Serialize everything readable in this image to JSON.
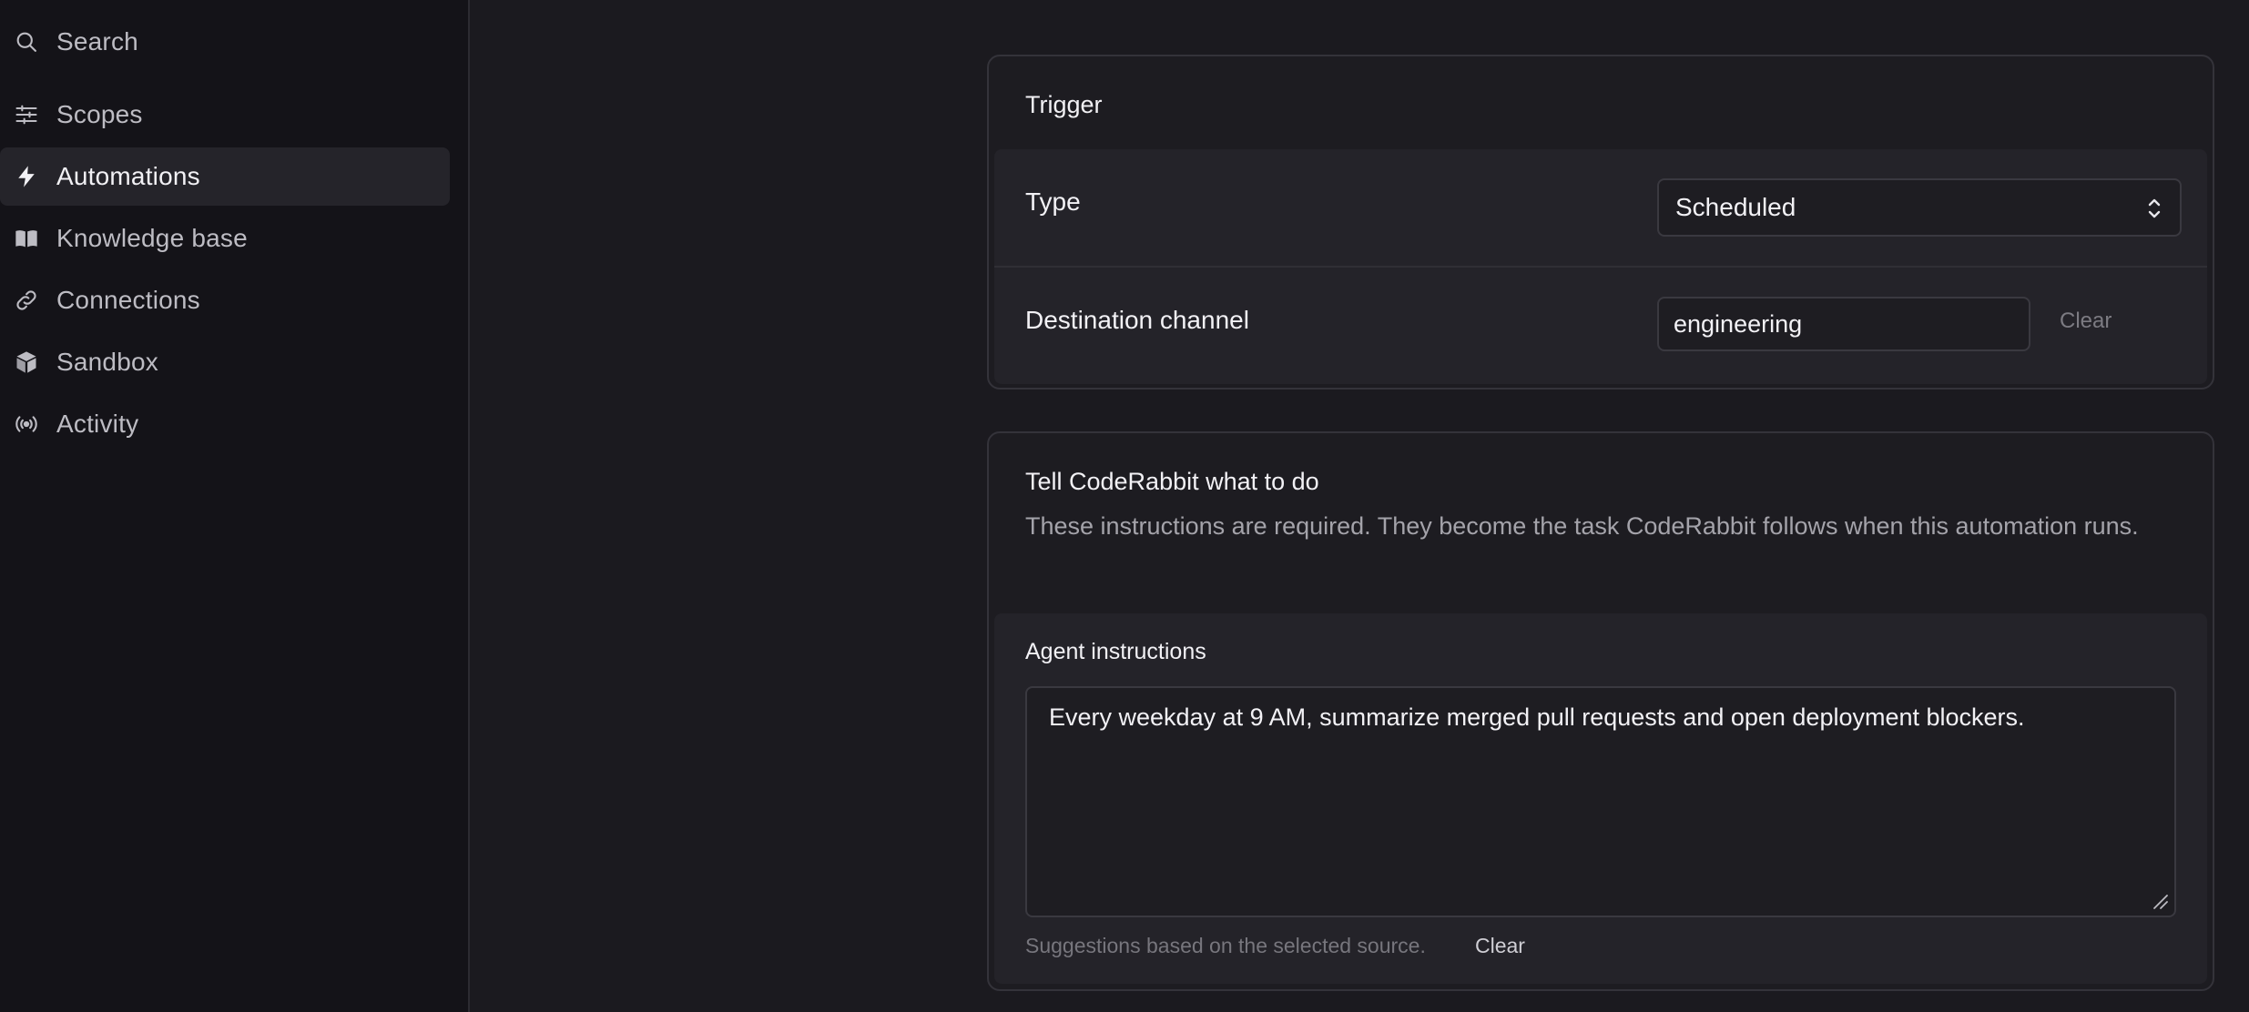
{
  "sidebar": {
    "items": [
      {
        "label": "Search",
        "icon": "search-icon"
      },
      {
        "label": "Scopes",
        "icon": "sliders-icon"
      },
      {
        "label": "Automations",
        "icon": "lightning-icon",
        "active": true
      },
      {
        "label": "Knowledge base",
        "icon": "book-icon"
      },
      {
        "label": "Connections",
        "icon": "link-icon"
      },
      {
        "label": "Sandbox",
        "icon": "cube-icon"
      },
      {
        "label": "Activity",
        "icon": "broadcast-icon"
      }
    ]
  },
  "trigger": {
    "title": "Trigger",
    "type_label": "Type",
    "type_value": "Scheduled",
    "destination_label": "Destination channel",
    "destination_value": "engineering",
    "clear_label": "Clear"
  },
  "instructions": {
    "title": "Tell CodeRabbit what to do",
    "description": "These instructions are required. They become the task CodeRabbit follows when this automation runs.",
    "field_label": "Agent instructions",
    "field_value": "Every weekday at 9 AM, summarize merged pull requests and open deployment blockers.",
    "hint": "Suggestions based on the selected source.",
    "clear_label": "Clear"
  }
}
